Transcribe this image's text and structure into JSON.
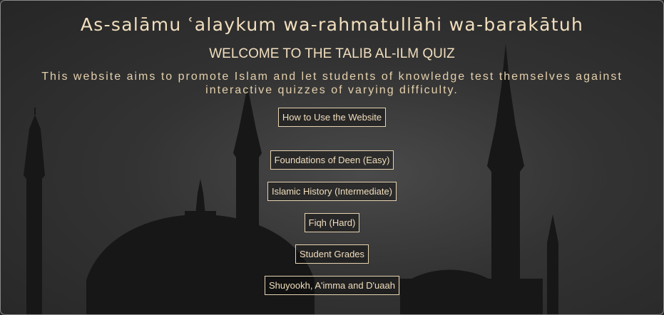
{
  "header": {
    "greeting": "As-salāmu ʿalaykum wa-rahmatullāhi wa-barakātuh",
    "welcome": "WELCOME TO THE TALIB AL-ILM QUIZ",
    "intro": "This website aims to promote Islam and let students of knowledge test themselves against interactive quizzes of varying difficulty."
  },
  "menu": {
    "how_to": "How to Use the Website",
    "quizzes": [
      "Foundations of Deen (Easy)",
      "Islamic History (Intermediate)",
      "Fiqh (Hard)"
    ],
    "grades": "Student Grades",
    "scholars": "Shuyookh, A'imma and D'uaah"
  },
  "colors": {
    "accent_text": "#f2dfbe",
    "button_border": "#e8d4b2",
    "background": "#2a2a2a"
  }
}
